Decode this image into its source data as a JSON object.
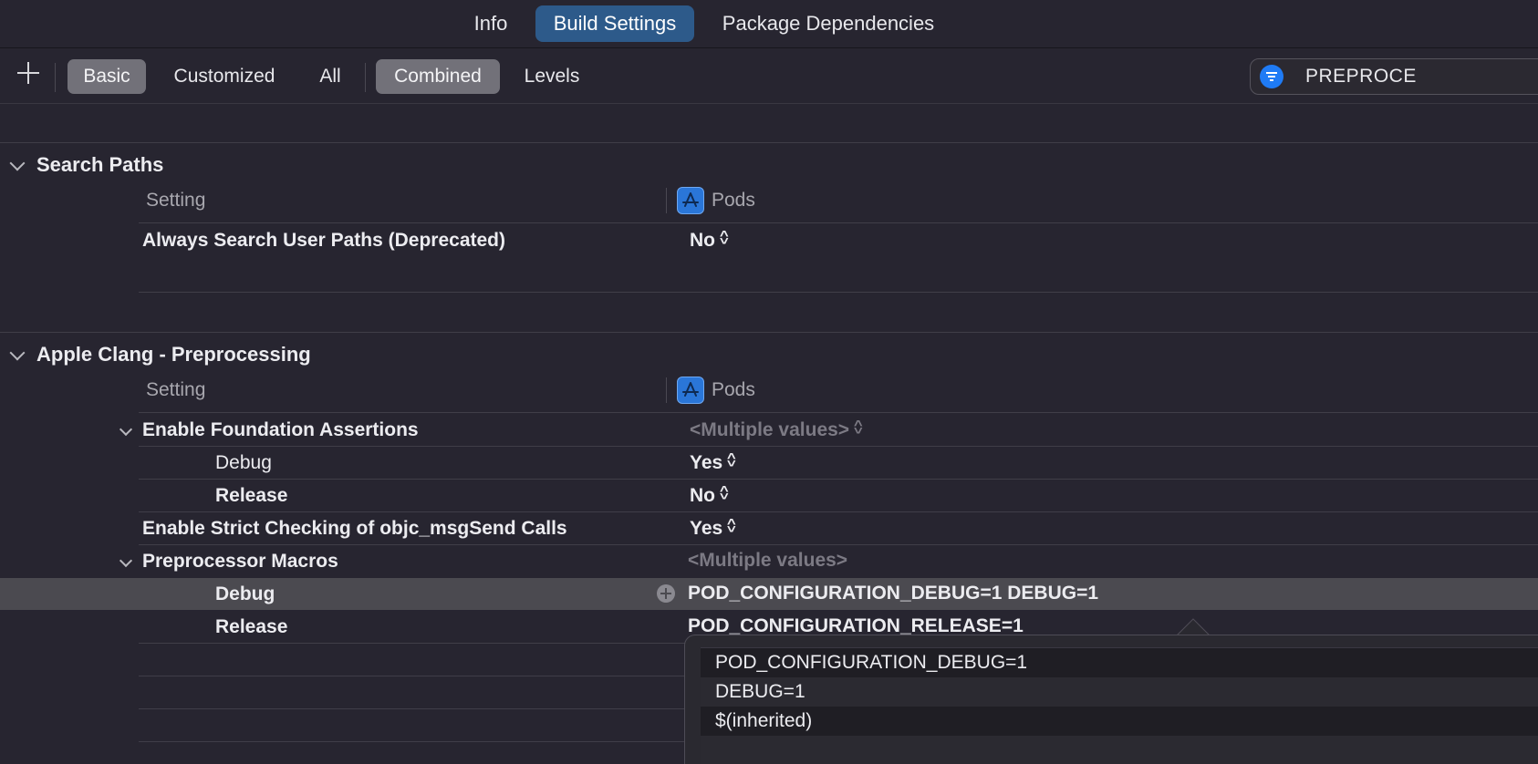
{
  "tabs": [
    {
      "label": "Info"
    },
    {
      "label": "Build Settings"
    },
    {
      "label": "Package Dependencies"
    }
  ],
  "filterbar": {
    "segments_scope": [
      {
        "label": "Basic"
      },
      {
        "label": "Customized"
      },
      {
        "label": "All"
      }
    ],
    "segments_view": [
      {
        "label": "Combined"
      },
      {
        "label": "Levels"
      }
    ],
    "search_value": "PREPROCE"
  },
  "sections": [
    {
      "title": "Search Paths",
      "col_setting": "Setting",
      "col_target": "Pods",
      "rows": [
        {
          "name": "Always Search User Paths (Deprecated)",
          "value": "No"
        }
      ]
    },
    {
      "title": "Apple Clang - Preprocessing",
      "col_setting": "Setting",
      "col_target": "Pods",
      "rows": [
        {
          "name": "Enable Foundation Assertions",
          "value": "<Multiple values>"
        },
        {
          "name": "Debug",
          "value": "Yes"
        },
        {
          "name": "Release",
          "value": "No"
        },
        {
          "name": "Enable Strict Checking of objc_msgSend Calls",
          "value": "Yes"
        },
        {
          "name": "Preprocessor Macros",
          "value": "<Multiple values>"
        },
        {
          "name": "Debug",
          "value": "POD_CONFIGURATION_DEBUG=1 DEBUG=1"
        },
        {
          "name": "Release",
          "value": "POD_CONFIGURATION_RELEASE=1"
        }
      ]
    }
  ],
  "popover": {
    "items": [
      "POD_CONFIGURATION_DEBUG=1",
      "DEBUG=1",
      "$(inherited)"
    ]
  },
  "colors": {
    "background": "#272530",
    "accent": "#2d5a8a",
    "selected_row": "#4b4a50"
  }
}
